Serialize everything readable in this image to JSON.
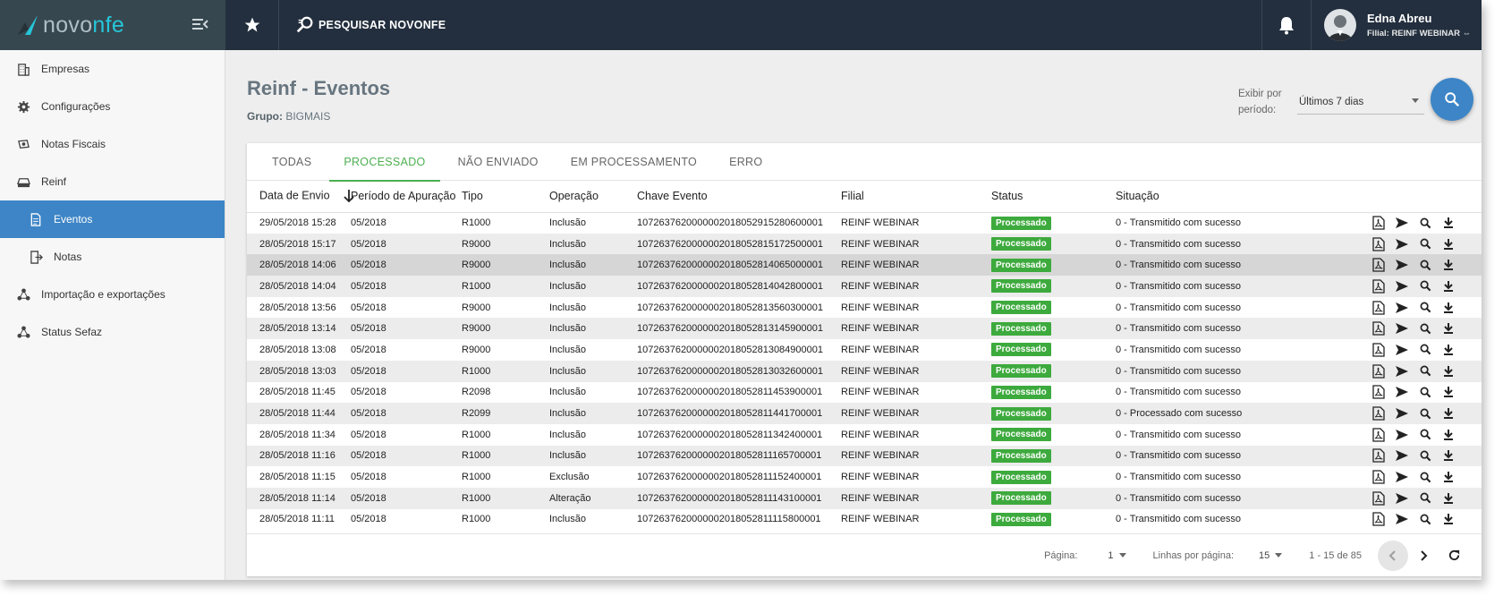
{
  "brand": {
    "name_prefix": "novo",
    "name_suffix": "nfe"
  },
  "topbar": {
    "search_label": "PESQUISAR NOVONFE",
    "user_name": "Edna Abreu",
    "user_filial": "Filial: REINF WEBINAR"
  },
  "sidebar": {
    "items": [
      {
        "label": "Empresas",
        "icon": "building-icon"
      },
      {
        "label": "Configurações",
        "icon": "gear-icon"
      },
      {
        "label": "Notas Fiscais",
        "icon": "money-icon"
      },
      {
        "label": "Reinf",
        "icon": "inbox-tray-icon"
      },
      {
        "label": "Eventos",
        "icon": "document-icon"
      },
      {
        "label": "Notas",
        "icon": "export-icon"
      },
      {
        "label": "Importação e exportações",
        "icon": "share-icon"
      },
      {
        "label": "Status Sefaz",
        "icon": "share-icon"
      }
    ]
  },
  "page": {
    "title": "Reinf - Eventos",
    "grupo_label": "Grupo:",
    "grupo_value": "BIGMAIS",
    "period_label": "Exibir por período:",
    "period_value": "Últimos 7 dias"
  },
  "tabs": [
    "TODAS",
    "PROCESSADO",
    "NÃO ENVIADO",
    "EM PROCESSAMENTO",
    "ERRO"
  ],
  "active_tab": "PROCESSADO",
  "table": {
    "headers": [
      "Data de Envio",
      "Período de Apuração",
      "Tipo",
      "Operação",
      "Chave Evento",
      "Filial",
      "Status",
      "Situação"
    ],
    "rows": [
      [
        "29/05/2018 15:28",
        "05/2018",
        "R1000",
        "Inclusão",
        "1072637620000002018052915280600001",
        "REINF WEBINAR",
        "Processado",
        "0 - Transmitido com sucesso"
      ],
      [
        "28/05/2018 15:17",
        "05/2018",
        "R9000",
        "Inclusão",
        "1072637620000002018052815172500001",
        "REINF WEBINAR",
        "Processado",
        "0 - Transmitido com sucesso"
      ],
      [
        "28/05/2018 14:06",
        "05/2018",
        "R9000",
        "Inclusão",
        "1072637620000002018052814065000001",
        "REINF WEBINAR",
        "Processado",
        "0 - Transmitido com sucesso"
      ],
      [
        "28/05/2018 14:04",
        "05/2018",
        "R1000",
        "Inclusão",
        "1072637620000002018052814042800001",
        "REINF WEBINAR",
        "Processado",
        "0 - Transmitido com sucesso"
      ],
      [
        "28/05/2018 13:56",
        "05/2018",
        "R9000",
        "Inclusão",
        "1072637620000002018052813560300001",
        "REINF WEBINAR",
        "Processado",
        "0 - Transmitido com sucesso"
      ],
      [
        "28/05/2018 13:14",
        "05/2018",
        "R9000",
        "Inclusão",
        "1072637620000002018052813145900001",
        "REINF WEBINAR",
        "Processado",
        "0 - Transmitido com sucesso"
      ],
      [
        "28/05/2018 13:08",
        "05/2018",
        "R9000",
        "Inclusão",
        "1072637620000002018052813084900001",
        "REINF WEBINAR",
        "Processado",
        "0 - Transmitido com sucesso"
      ],
      [
        "28/05/2018 13:03",
        "05/2018",
        "R1000",
        "Inclusão",
        "1072637620000002018052813032600001",
        "REINF WEBINAR",
        "Processado",
        "0 - Transmitido com sucesso"
      ],
      [
        "28/05/2018 11:45",
        "05/2018",
        "R2098",
        "Inclusão",
        "1072637620000002018052811453900001",
        "REINF WEBINAR",
        "Processado",
        "0 - Transmitido com sucesso"
      ],
      [
        "28/05/2018 11:44",
        "05/2018",
        "R2099",
        "Inclusão",
        "1072637620000002018052811441700001",
        "REINF WEBINAR",
        "Processado",
        "0 - Processado com sucesso"
      ],
      [
        "28/05/2018 11:34",
        "05/2018",
        "R1000",
        "Inclusão",
        "1072637620000002018052811342400001",
        "REINF WEBINAR",
        "Processado",
        "0 - Transmitido com sucesso"
      ],
      [
        "28/05/2018 11:16",
        "05/2018",
        "R1000",
        "Inclusão",
        "1072637620000002018052811165700001",
        "REINF WEBINAR",
        "Processado",
        "0 - Transmitido com sucesso"
      ],
      [
        "28/05/2018 11:15",
        "05/2018",
        "R1000",
        "Exclusão",
        "1072637620000002018052811152400001",
        "REINF WEBINAR",
        "Processado",
        "0 - Transmitido com sucesso"
      ],
      [
        "28/05/2018 11:14",
        "05/2018",
        "R1000",
        "Alteração",
        "1072637620000002018052811143100001",
        "REINF WEBINAR",
        "Processado",
        "0 - Transmitido com sucesso"
      ],
      [
        "28/05/2018 11:11",
        "05/2018",
        "R1000",
        "Inclusão",
        "1072637620000002018052811115800001",
        "REINF WEBINAR",
        "Processado",
        "0 - Transmitido com sucesso"
      ]
    ],
    "row_actions": [
      "pdf-icon",
      "send-icon",
      "search-icon",
      "download-icon"
    ]
  },
  "pager": {
    "page_label": "Página:",
    "page_value": "1",
    "rows_label": "Linhas por página:",
    "rows_value": "15",
    "range": "1 - 15 de 85"
  },
  "colors": {
    "accent": "#3d85c6",
    "success": "#3daa3d",
    "topbar": "#232f3e",
    "active_tab": "#4caf50"
  }
}
